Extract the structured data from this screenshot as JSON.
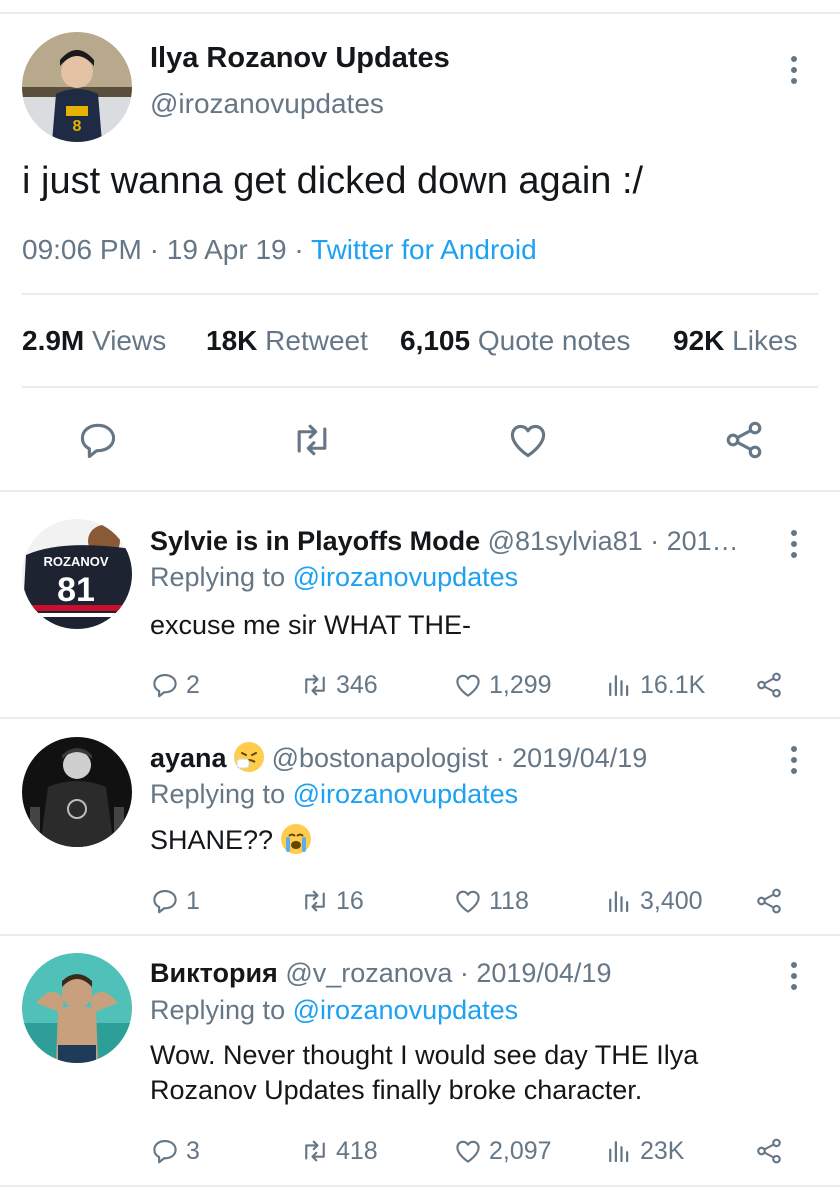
{
  "tweet": {
    "display_name": "Ilya Rozanov Updates",
    "handle": "@irozanovupdates",
    "text": "i just wanna get dicked down again :/",
    "time": "09:06 PM",
    "date": "19 Apr 19",
    "source": "Twitter for Android",
    "stats": {
      "views_count": "2.9M",
      "views_label": "Views",
      "retweet_count": "18K",
      "retweet_label": "Retweet",
      "quote_count": "6,105",
      "quote_label": "Quote notes",
      "likes_count": "92K",
      "likes_label": "Likes"
    }
  },
  "replies": [
    {
      "display_name": "Sylvie is in Playoffs Mode",
      "handle_date": "@81sylvia81 · 201…",
      "replying_prefix": "Replying to",
      "replying_to": "@irozanovupdates",
      "text": "excuse me sir WHAT THE-",
      "replies": "2",
      "retweets": "346",
      "likes": "1,299",
      "views": "16.1K",
      "avatar_text": "ROZANOV",
      "avatar_number": "81"
    },
    {
      "display_name": "ayana",
      "emoji": "sneezing-face",
      "handle_date": "@bostonapologist · 2019/04/19",
      "replying_prefix": "Replying to",
      "replying_to": "@irozanovupdates",
      "text": "SHANE??",
      "text_emoji": "crying-face",
      "replies": "1",
      "retweets": "16",
      "likes": "118",
      "views": "3,400"
    },
    {
      "display_name": "Виктория",
      "handle_date": "@v_rozanova · 2019/04/19",
      "replying_prefix": "Replying to",
      "replying_to": "@irozanovupdates",
      "text": "Wow. Never thought I would see day THE Ilya Rozanov Updates finally broke character.",
      "replies": "3",
      "retweets": "418",
      "likes": "2,097",
      "views": "23K"
    }
  ],
  "colors": {
    "accent": "#1da1f2",
    "muted": "#657786",
    "text": "#14171a",
    "divider": "#e6ecf0"
  },
  "icons": [
    "reply-icon",
    "retweet-icon",
    "like-icon",
    "share-icon",
    "views-icon",
    "more-icon"
  ]
}
